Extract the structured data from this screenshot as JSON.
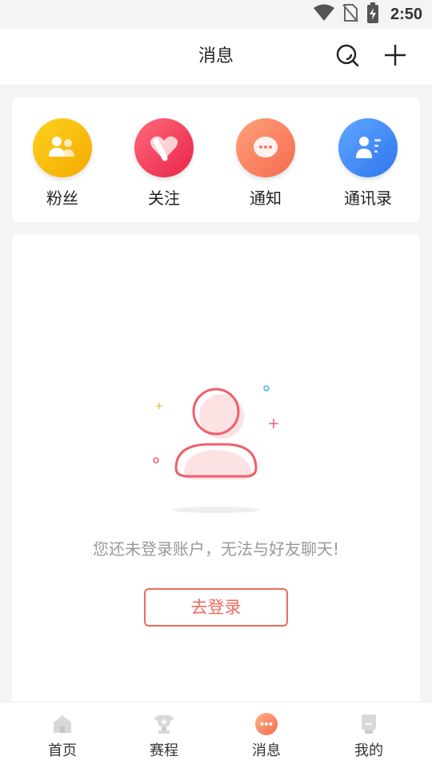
{
  "status_bar": {
    "time": "2:50"
  },
  "header": {
    "title": "消息"
  },
  "shortcuts": [
    {
      "label": "粉丝",
      "icon": "fans-icon",
      "color": "#f5b800"
    },
    {
      "label": "关注",
      "icon": "heart-follow-icon",
      "color": "#f2405a"
    },
    {
      "label": "通知",
      "icon": "chat-bubble-icon",
      "color": "#fb7a5c"
    },
    {
      "label": "通讯录",
      "icon": "contacts-icon",
      "color": "#3d86f6"
    }
  ],
  "empty_state": {
    "message": "您还未登录账户，无法与好友聊天!",
    "login_button": "去登录",
    "accent_color": "#ee6b5f"
  },
  "tabbar": {
    "items": [
      {
        "label": "首页",
        "icon": "home-icon",
        "active": false
      },
      {
        "label": "赛程",
        "icon": "trophy-icon",
        "active": false
      },
      {
        "label": "消息",
        "icon": "message-icon",
        "active": true
      },
      {
        "label": "我的",
        "icon": "profile-icon",
        "active": false
      }
    ]
  }
}
